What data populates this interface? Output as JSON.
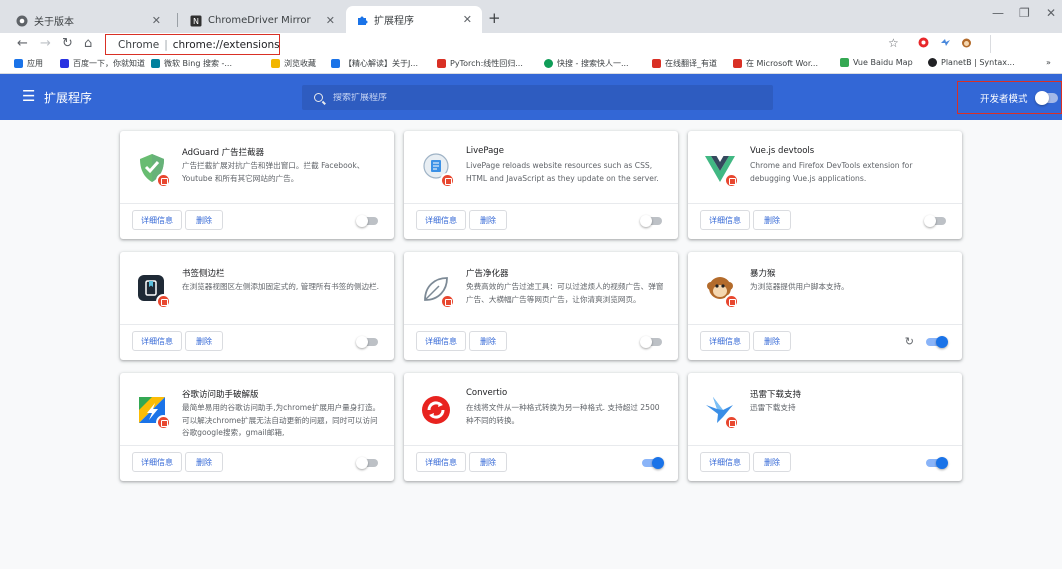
{
  "tabs": [
    {
      "title": "关于版本",
      "icon": "chrome-icon",
      "active": false
    },
    {
      "title": "ChromeDriver Mirror",
      "icon": "nodejs-icon",
      "active": false
    },
    {
      "title": "扩展程序",
      "icon": "puzzle-icon",
      "active": true
    }
  ],
  "newtab": "+",
  "window_controls": {
    "minimize": "—",
    "restore": "❐",
    "close": "✕"
  },
  "omnibox": {
    "chrome_label": "Chrome",
    "separator": "|",
    "url": "chrome://extensions"
  },
  "bookmarks": [
    {
      "label": "应用",
      "color": "#1a73e8"
    },
    {
      "label": "百度一下，你就知道",
      "color": "#2932e1"
    },
    {
      "label": "微软 Bing 搜索 -...",
      "color": "#00809d"
    },
    {
      "label": "浏览收藏",
      "color": "#f2b600"
    },
    {
      "label": "【精心解读】关于J...",
      "color": "#1a73e8"
    },
    {
      "label": "PyTorch:线性回归...",
      "color": "#d93025"
    },
    {
      "label": "快搜 - 搜索快人一...",
      "color": "#0f9d58"
    },
    {
      "label": "在线翻译_有道",
      "color": "#d93025"
    },
    {
      "label": "在 Microsoft Wor...",
      "color": "#d93025"
    },
    {
      "label": "Vue Baidu Map",
      "color": "#34a853"
    },
    {
      "label": "PlanetB | Syntax...",
      "color": "#202124"
    }
  ],
  "bookmarks_more": "»",
  "header": {
    "title": "扩展程序",
    "search_placeholder": "搜索扩展程序",
    "dev_mode_label": "开发者模式",
    "dev_mode_on": false
  },
  "cards": [
    {
      "name": "AdGuard 广告拦截器",
      "desc": "广告拦截扩展对抗广告和弹出窗口。拦截 Facebook、Youtube 和所有其它网站的广告。",
      "details": "详细信息",
      "remove": "删除",
      "enabled": false,
      "reload": false
    },
    {
      "name": "LivePage",
      "desc": "LivePage reloads website resources such as CSS, HTML and JavaScript as they update on the server.",
      "details": "详细信息",
      "remove": "删除",
      "enabled": false,
      "reload": false
    },
    {
      "name": "Vue.js devtools",
      "desc": "Chrome and Firefox DevTools extension for debugging Vue.js applications.",
      "details": "详细信息",
      "remove": "删除",
      "enabled": false,
      "reload": false
    },
    {
      "name": "书签侧边栏",
      "desc": "在浏览器视图区左侧添加固定式的, 管理所有书签的侧边栏.",
      "details": "详细信息",
      "remove": "删除",
      "enabled": false,
      "reload": false
    },
    {
      "name": "广告净化器",
      "desc": "免费高效的广告过滤工具：可以过滤烦人的视频广告、弹窗广告、大横幅广告等网页广告，让你清爽浏览网页。",
      "details": "详细信息",
      "remove": "删除",
      "enabled": false,
      "reload": false
    },
    {
      "name": "暴力猴",
      "desc": "为浏览器提供用户脚本支持。",
      "details": "详细信息",
      "remove": "删除",
      "enabled": true,
      "reload": true
    },
    {
      "name": "谷歌访问助手破解版",
      "desc": "最简单易用的谷歌访问助手,为chrome扩展用户量身打造。可以解决chrome扩展无法自动更新的问题，同时可以访问谷歌google搜索，gmail邮箱,",
      "details": "详细信息",
      "remove": "删除",
      "enabled": false,
      "reload": false
    },
    {
      "name": "Convertio",
      "desc": "在线将文件从一种格式转换为另一种格式. 支持超过 2500 种不同的转换。",
      "details": "详细信息",
      "remove": "删除",
      "enabled": true,
      "reload": false
    },
    {
      "name": "迅雷下载支持",
      "desc": "迅雷下载支持",
      "details": "详细信息",
      "remove": "删除",
      "enabled": true,
      "reload": false
    }
  ]
}
